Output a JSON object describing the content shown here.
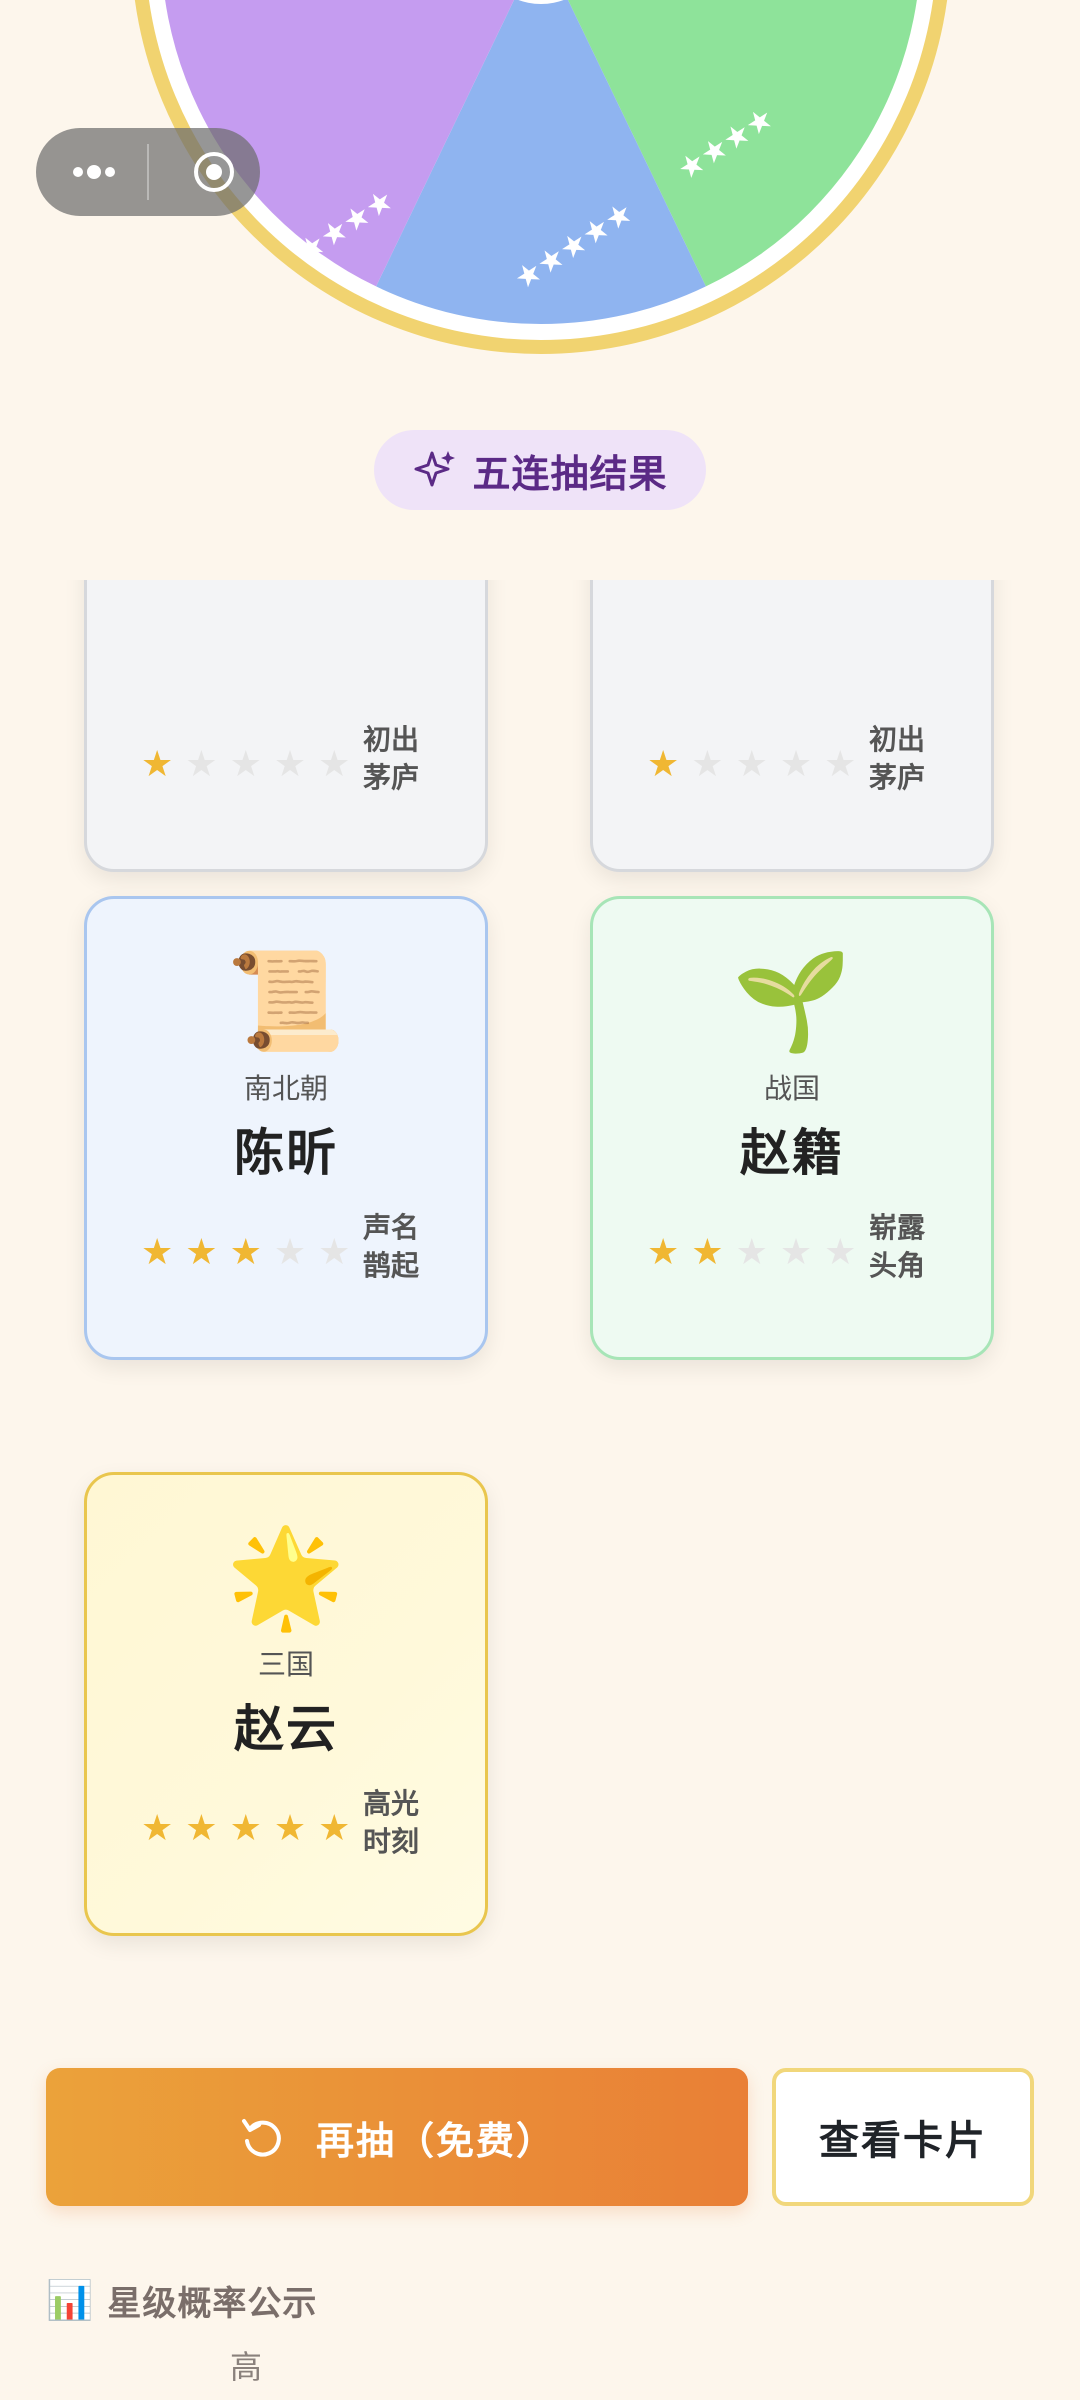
{
  "pill": {
    "label": "五连抽结果"
  },
  "cards": [
    {
      "dynasty": "",
      "name": "",
      "stars": 1,
      "badge_line1": "初出",
      "badge_line2": "茅庐",
      "icon": ""
    },
    {
      "dynasty": "",
      "name": "",
      "stars": 1,
      "badge_line1": "初出",
      "badge_line2": "茅庐",
      "icon": ""
    },
    {
      "dynasty": "南北朝",
      "name": "陈昕",
      "stars": 3,
      "badge_line1": "声名",
      "badge_line2": "鹊起",
      "icon": "📜"
    },
    {
      "dynasty": "战国",
      "name": "赵籍",
      "stars": 2,
      "badge_line1": "崭露",
      "badge_line2": "头角",
      "icon": "🌱"
    },
    {
      "dynasty": "三国",
      "name": "赵云",
      "stars": 5,
      "badge_line1": "高光",
      "badge_line2": "时刻",
      "icon": "🌟"
    }
  ],
  "actions": {
    "redraw_label": "再抽（免费）",
    "view_cards_label": "查看卡片"
  },
  "probability": {
    "icon": "📊",
    "title": "星级概率公示",
    "first_tick": "高"
  },
  "colors": {
    "background": "#fdf6ec",
    "accent_orange": "#e98f36",
    "star_gold": "#f0b733",
    "pill_text": "#5b2a86",
    "wheel_rim": "#f1d370"
  }
}
